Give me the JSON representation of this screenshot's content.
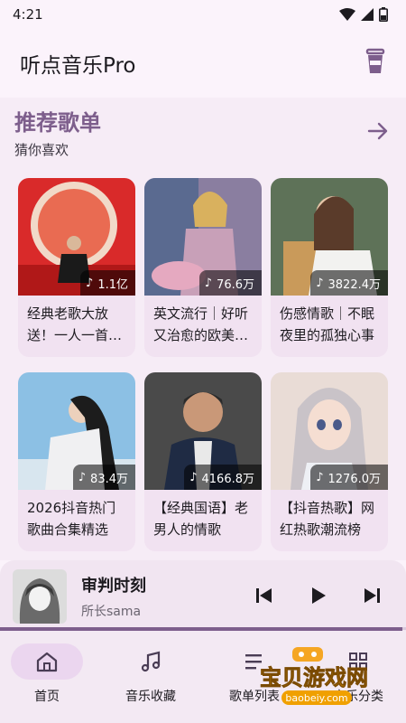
{
  "status": {
    "time": "4:21"
  },
  "app": {
    "title": "听点音乐Pro"
  },
  "section": {
    "title": "推荐歌单",
    "subtitle": "猜你喜欢"
  },
  "playlists": [
    {
      "title": "经典老歌大放送！一人一首成名曲",
      "count": "1.1亿"
    },
    {
      "title": "英文流行｜好听又治愈的欧美歌曲",
      "count": "76.6万"
    },
    {
      "title": "伤感情歌｜不眠夜里的孤独心事",
      "count": "3822.4万"
    },
    {
      "title": "2026抖音热门歌曲合集精选",
      "count": "83.4万"
    },
    {
      "title": "【经典国语】老男人的情歌",
      "count": "4166.8万"
    },
    {
      "title": "【抖音热歌】网红热歌潮流榜",
      "count": "1276.0万"
    }
  ],
  "player": {
    "title": "审判时刻",
    "artist": "所长sama",
    "progress": 0.99
  },
  "nav": [
    {
      "label": "首页",
      "icon": "home-icon",
      "active": true
    },
    {
      "label": "音乐收藏",
      "icon": "music-note-icon",
      "active": false
    },
    {
      "label": "歌单列表",
      "icon": "list-icon",
      "active": false
    },
    {
      "label": "音乐分类",
      "icon": "category-icon",
      "active": false
    }
  ],
  "watermark": {
    "text": "宝贝游戏网",
    "url": "baobeiy.com"
  },
  "colors": {
    "accent": "#7d5e8c",
    "background": "#fbf3fb",
    "nav_active": "#ebd6ef"
  }
}
